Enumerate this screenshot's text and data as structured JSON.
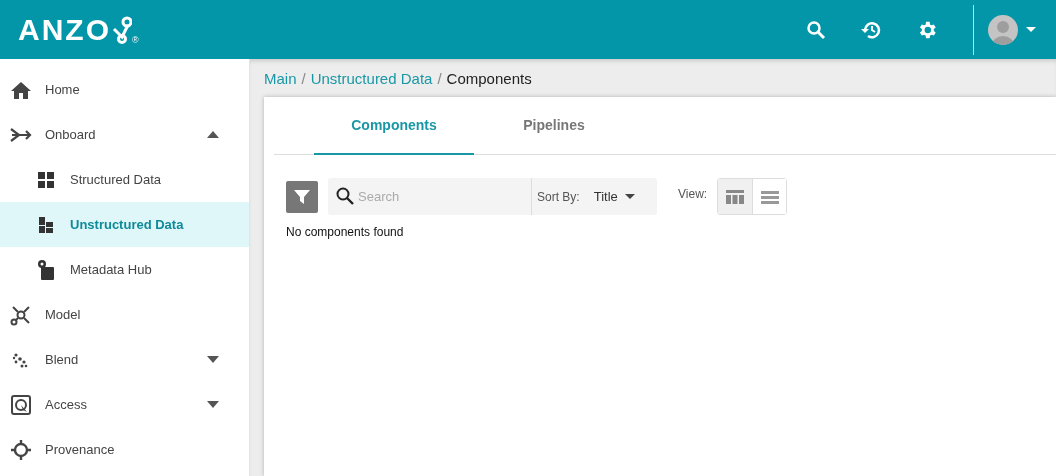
{
  "header": {
    "logo": "ANZO",
    "registered": "®"
  },
  "sidebar": {
    "items": [
      {
        "label": "Home",
        "selected": false
      },
      {
        "label": "Onboard",
        "selected": false,
        "expanded": true,
        "children": [
          {
            "label": "Structured Data",
            "selected": false
          },
          {
            "label": "Unstructured Data",
            "selected": true
          },
          {
            "label": "Metadata Hub",
            "selected": false
          }
        ]
      },
      {
        "label": "Model",
        "selected": false
      },
      {
        "label": "Blend",
        "selected": false,
        "expanded": false
      },
      {
        "label": "Access",
        "selected": false,
        "expanded": false
      },
      {
        "label": "Provenance",
        "selected": false
      }
    ]
  },
  "breadcrumb": [
    {
      "label": "Main",
      "link": true
    },
    {
      "label": "Unstructured Data",
      "link": true
    },
    {
      "label": "Components",
      "link": false
    }
  ],
  "breadcrumb_separator": "/",
  "tabs": [
    {
      "label": "Components",
      "selected": true
    },
    {
      "label": "Pipelines",
      "selected": false
    }
  ],
  "search": {
    "placeholder": "Search"
  },
  "sort": {
    "label": "Sort By:",
    "value": "Title"
  },
  "view": {
    "label": "View:",
    "options": [
      {
        "kind": "grid",
        "selected": true
      },
      {
        "kind": "list",
        "selected": false
      }
    ]
  },
  "empty_message": "No components found"
}
